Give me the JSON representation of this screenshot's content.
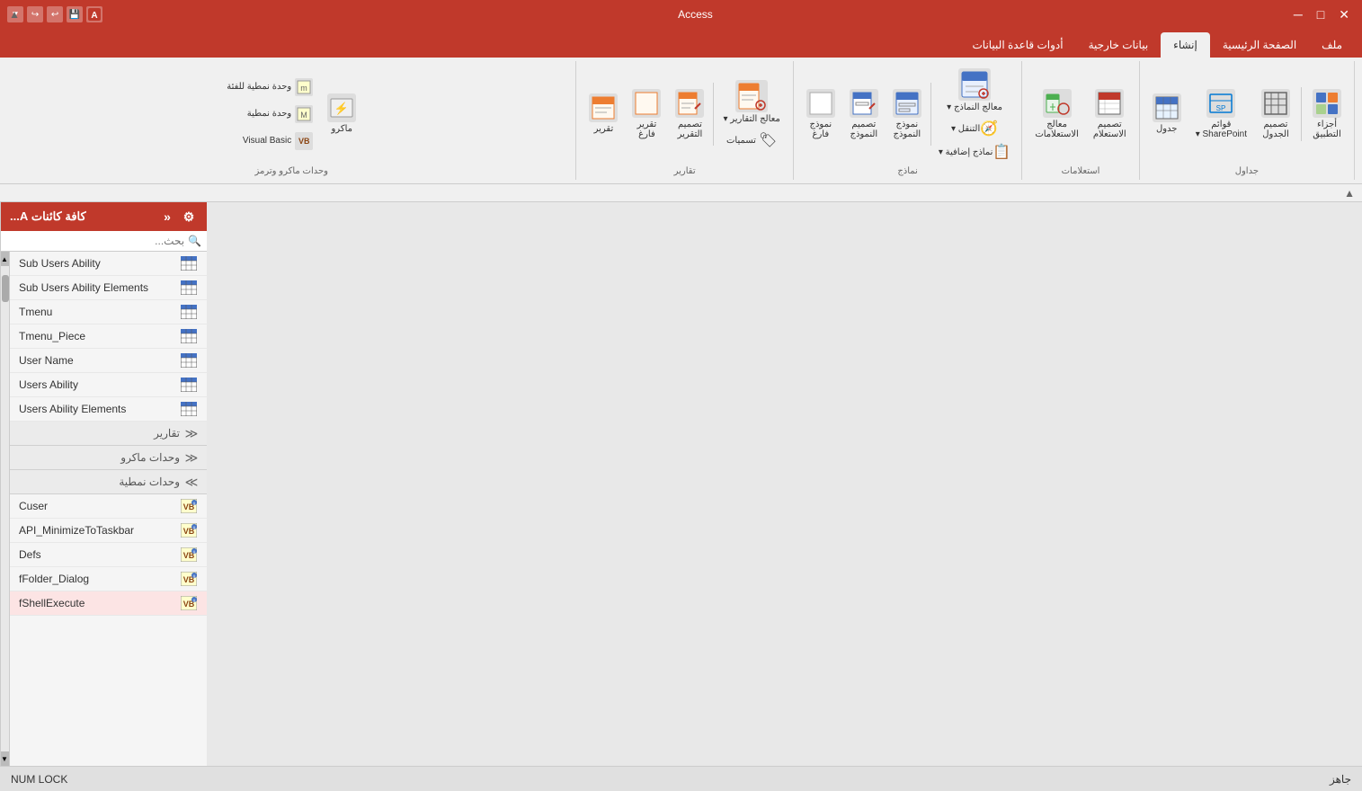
{
  "titleBar": {
    "title": "Access",
    "closeBtn": "✕",
    "minimizeBtn": "─",
    "maximizeBtn": "□",
    "restoreBtn": "❐"
  },
  "ribbonTabs": [
    {
      "id": "file",
      "label": "ملف",
      "active": false
    },
    {
      "id": "home",
      "label": "الصفحة الرئيسية",
      "active": false
    },
    {
      "id": "create",
      "label": "إنشاء",
      "active": true
    },
    {
      "id": "external",
      "label": "بيانات خارجية",
      "active": false
    },
    {
      "id": "dbtools",
      "label": "أدوات قاعدة البيانات",
      "active": false
    }
  ],
  "ribbonGroups": [
    {
      "id": "tables",
      "label": "جداول",
      "items": [
        {
          "id": "app-parts",
          "icon": "📋",
          "label": "أجزاء\nالتطبيق",
          "hasDropdown": true
        },
        {
          "id": "table-design",
          "icon": "⊞",
          "label": "تصميم\nالجدول"
        },
        {
          "id": "table-list",
          "icon": "≡",
          "label": "قوائم\nSharePoint",
          "hasDropdown": true
        },
        {
          "id": "table",
          "icon": "⊡",
          "label": "جدول"
        }
      ]
    },
    {
      "id": "queries",
      "label": "استعلامات",
      "items": [
        {
          "id": "query-design",
          "icon": "⊟",
          "label": "تصميم\nالاستعلام"
        },
        {
          "id": "query-wizard",
          "icon": "🔧",
          "label": "معالج\nالاستعلامات"
        }
      ]
    },
    {
      "id": "forms",
      "label": "نماذج",
      "items": [
        {
          "id": "form-wizard",
          "icon": "📝",
          "label": "معالج النماذج",
          "hasDropdown": true
        },
        {
          "id": "navigate",
          "icon": "🧭",
          "label": "التنقل",
          "hasDropdown": true
        },
        {
          "id": "more-forms",
          "icon": "📄",
          "label": "نماذج إضافية",
          "hasDropdown": true
        },
        {
          "id": "form",
          "icon": "📃",
          "label": "نموذج\nالنموذج"
        },
        {
          "id": "form-design",
          "icon": "✏️",
          "label": "تصميم\nالنموذج"
        },
        {
          "id": "blank-form",
          "icon": "⬜",
          "label": "نموذج\nفارغ"
        }
      ]
    },
    {
      "id": "reports",
      "label": "تقارير",
      "items": [
        {
          "id": "report-wizard",
          "icon": "📊",
          "label": "معالج التقارير",
          "hasDropdown": true
        },
        {
          "id": "labels",
          "icon": "🏷",
          "label": "تسميات"
        },
        {
          "id": "report-design",
          "icon": "📐",
          "label": "تصميم\nالتقرير"
        },
        {
          "id": "report-blank",
          "icon": "📄",
          "label": "تقرير\nفارغ"
        },
        {
          "id": "report",
          "icon": "📋",
          "label": "تقرير"
        }
      ]
    },
    {
      "id": "macros",
      "label": "وحدات ماكرو وترمز",
      "items": [
        {
          "id": "macro",
          "icon": "⚡",
          "label": "ماكرو"
        },
        {
          "id": "module",
          "icon": "📦",
          "label": "وحدة نمطية للفئة"
        },
        {
          "id": "class-module",
          "icon": "📦",
          "label": "وحدة نمطية"
        },
        {
          "id": "visual-basic",
          "icon": "VB",
          "label": "Visual Basic"
        }
      ]
    }
  ],
  "navPanel": {
    "title": "كافة كائنات A...",
    "searchPlaceholder": "بحث...",
    "expandIcon": "»",
    "configIcon": "⚙"
  },
  "navItems": [
    {
      "id": "sub-users-ability",
      "label": "Sub Users Ability",
      "type": "table",
      "section": null
    },
    {
      "id": "sub-users-ability-elements",
      "label": "Sub Users Ability Elements",
      "type": "table",
      "section": null
    },
    {
      "id": "tmenu",
      "label": "Tmenu",
      "type": "table",
      "section": null
    },
    {
      "id": "tmenu-piece",
      "label": "Tmenu_Piece",
      "type": "table",
      "section": null
    },
    {
      "id": "user-name",
      "label": "User Name",
      "type": "table",
      "section": null
    },
    {
      "id": "users-ability",
      "label": "Users Ability",
      "type": "table",
      "section": null
    },
    {
      "id": "users-ability-elements",
      "label": "Users Ability Elements",
      "type": "table",
      "section": null
    }
  ],
  "navSections": [
    {
      "id": "reports-section",
      "label": "تقارير",
      "collapsed": true
    },
    {
      "id": "macros-section",
      "label": "وحدات ماكرو",
      "collapsed": true
    },
    {
      "id": "modules-section",
      "label": "وحدات نمطية",
      "collapsed": false
    }
  ],
  "navModules": [
    {
      "id": "cuser",
      "label": "Cuser",
      "type": "module"
    },
    {
      "id": "api-minimize",
      "label": "API_MinimizeToTaskbar",
      "type": "module"
    },
    {
      "id": "defs",
      "label": "Defs",
      "type": "module"
    },
    {
      "id": "ffolder-dialog",
      "label": "fFolder_Dialog",
      "type": "module"
    },
    {
      "id": "fshellexecute",
      "label": "fShellExecute",
      "type": "module",
      "selected": true
    }
  ],
  "statusBar": {
    "text": "جاهز",
    "capslock": "NUM LOCK"
  }
}
